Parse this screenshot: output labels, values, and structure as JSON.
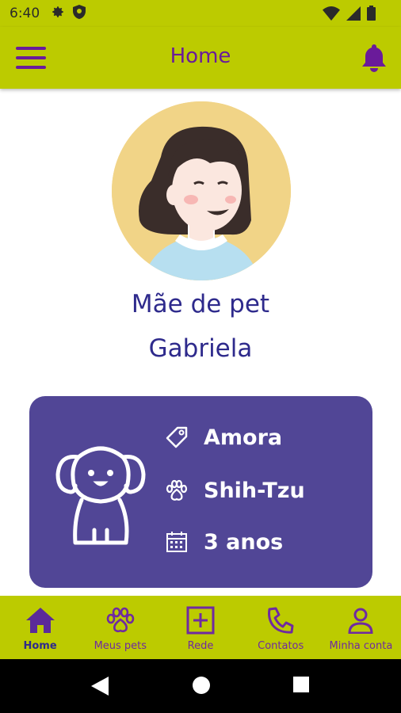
{
  "status_bar": {
    "time": "6:40"
  },
  "app_bar": {
    "title": "Home"
  },
  "profile": {
    "role": "Mãe de pet",
    "name": "Gabriela"
  },
  "pet": {
    "name": "Amora",
    "breed": "Shih-Tzu",
    "age": "3 anos"
  },
  "bottom_nav": {
    "items": [
      {
        "label": "Home",
        "icon": "home-icon",
        "active": true
      },
      {
        "label": "Meus pets",
        "icon": "paw-icon",
        "active": false
      },
      {
        "label": "Rede",
        "icon": "plus-square-icon",
        "active": false
      },
      {
        "label": "Contatos",
        "icon": "phone-icon",
        "active": false
      },
      {
        "label": "Minha conta",
        "icon": "user-icon",
        "active": false
      }
    ]
  },
  "colors": {
    "brand_lime": "#bccb00",
    "brand_purple": "#6a1b9a",
    "card_purple": "#514696",
    "text_indigo": "#2e2a8c"
  }
}
